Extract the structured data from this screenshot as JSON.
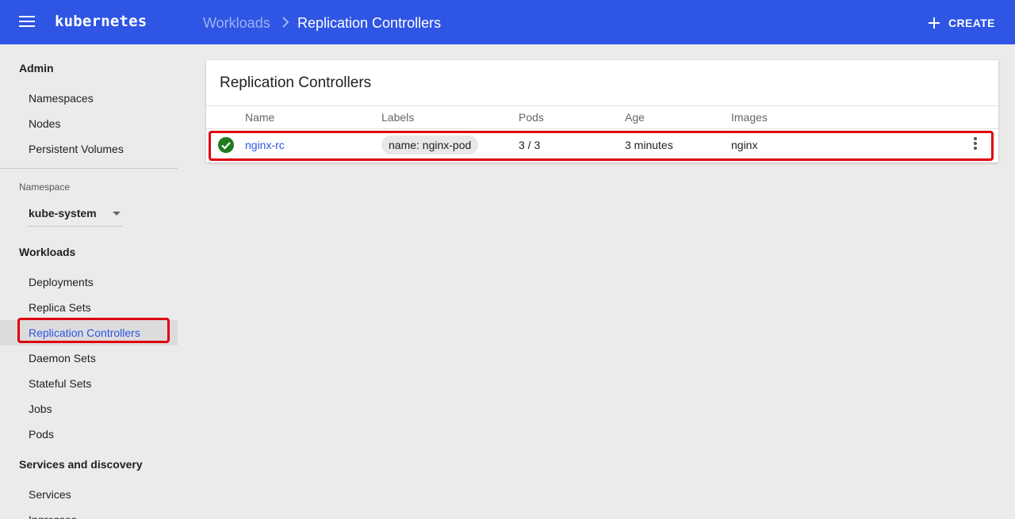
{
  "header": {
    "brand": "kubernetes",
    "breadcrumb_parent": "Workloads",
    "breadcrumb_current": "Replication Controllers",
    "create_label": "CREATE"
  },
  "sidebar": {
    "admin_title": "Admin",
    "admin_items": [
      "Namespaces",
      "Nodes",
      "Persistent Volumes"
    ],
    "namespace_label": "Namespace",
    "namespace_value": "kube-system",
    "workloads_title": "Workloads",
    "workload_items": [
      "Deployments",
      "Replica Sets",
      "Replication Controllers",
      "Daemon Sets",
      "Stateful Sets",
      "Jobs",
      "Pods"
    ],
    "active_item": "Replication Controllers",
    "services_title": "Services and discovery",
    "service_items": [
      "Services",
      "Ingresses"
    ]
  },
  "card": {
    "title": "Replication Controllers",
    "columns": [
      "Name",
      "Labels",
      "Pods",
      "Age",
      "Images"
    ],
    "rows": [
      {
        "status": "running",
        "name": "nginx-rc",
        "label": "name: nginx-pod",
        "pods": "3 / 3",
        "age": "3 minutes",
        "images": "nginx"
      }
    ]
  },
  "colors": {
    "header_bg": "#2f55e4",
    "accent": "#2f55e4",
    "highlight": "#e0000d",
    "status_ok": "#1e7b1e"
  },
  "icons": {
    "menu": "menu-icon",
    "breadcrumb_separator": "chevron-right-icon",
    "create": "plus-icon",
    "status": "check-circle-icon",
    "actions": "more-vert-icon",
    "dropdown": "caret-down-icon"
  }
}
